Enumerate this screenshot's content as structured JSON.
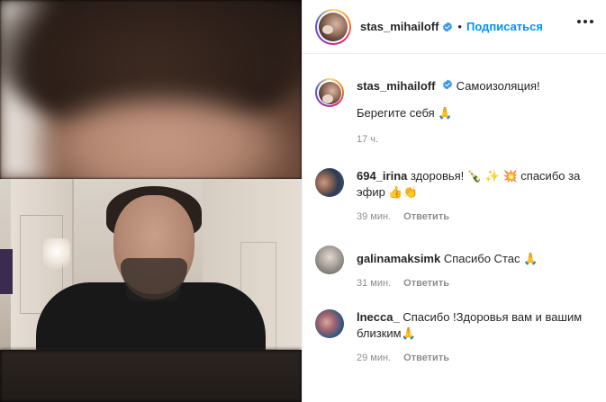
{
  "post": {
    "username": "stas_mihailoff",
    "follow_label": "Подписаться",
    "dot": "•"
  },
  "caption": {
    "username": "stas_mihailoff",
    "line1": "Самоизоляция!",
    "line2": "Берегите себя",
    "line2_emoji": "🙏",
    "time": "17 ч."
  },
  "comments": [
    {
      "username": "694_irina",
      "text": "здоровья! 🍾 ✨ 💥 спасибо за эфир 👍👏",
      "time": "39 мин.",
      "reply_label": "Ответить"
    },
    {
      "username": "galinamaksimk",
      "text": "Спасибо Стас 🙏",
      "time": "31 мин.",
      "reply_label": "Ответить"
    },
    {
      "username": "lnecca_",
      "text": "Спасибо !Здоровья вам и вашим близким🙏",
      "time": "29 мин.",
      "reply_label": "Ответить"
    }
  ],
  "colors": {
    "accent": "#0095f6",
    "verified": "#3897f0",
    "muted": "#8e8e8e",
    "text": "#262626"
  },
  "icons": {
    "verified": "verified-badge-icon",
    "more": "more-options-icon"
  }
}
